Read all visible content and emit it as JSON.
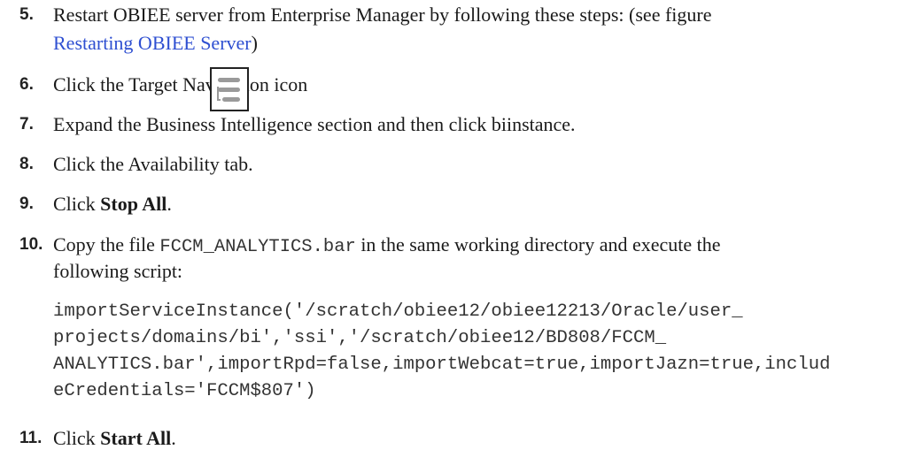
{
  "steps": [
    {
      "num": "5.",
      "line1": "Restart OBIEE server from Enterprise Manager by following these steps: (see figure",
      "link": "Restarting OBIEE Server",
      "line2_end": ")"
    },
    {
      "num": "6.",
      "text": "Click the Target Navigation icon"
    },
    {
      "num": "7.",
      "text": "Expand the Business Intelligence section and then click biinstance."
    },
    {
      "num": "8.",
      "text": "Click the Availability tab."
    },
    {
      "num": "9.",
      "pre": "Click ",
      "bold": "Stop All",
      "post": "."
    },
    {
      "num": "10.",
      "pre": "Copy the file ",
      "code": "FCCM_ANALYTICS.bar",
      "post": " in the same working directory and execute the",
      "line2": "following script:"
    },
    {
      "num": "11.",
      "pre": "Click ",
      "bold": "Start All",
      "post": "."
    }
  ],
  "script_lines": [
    "importServiceInstance('/scratch/obiee12/obiee12213/Oracle/user_",
    "projects/domains/bi','ssi','/scratch/obiee12/BD808/FCCM_",
    "ANALYTICS.bar',importRpd=false,importWebcat=true,importJazn=true,includ",
    "eCredentials='FCCM$807')"
  ],
  "icon": "target-navigation-icon"
}
